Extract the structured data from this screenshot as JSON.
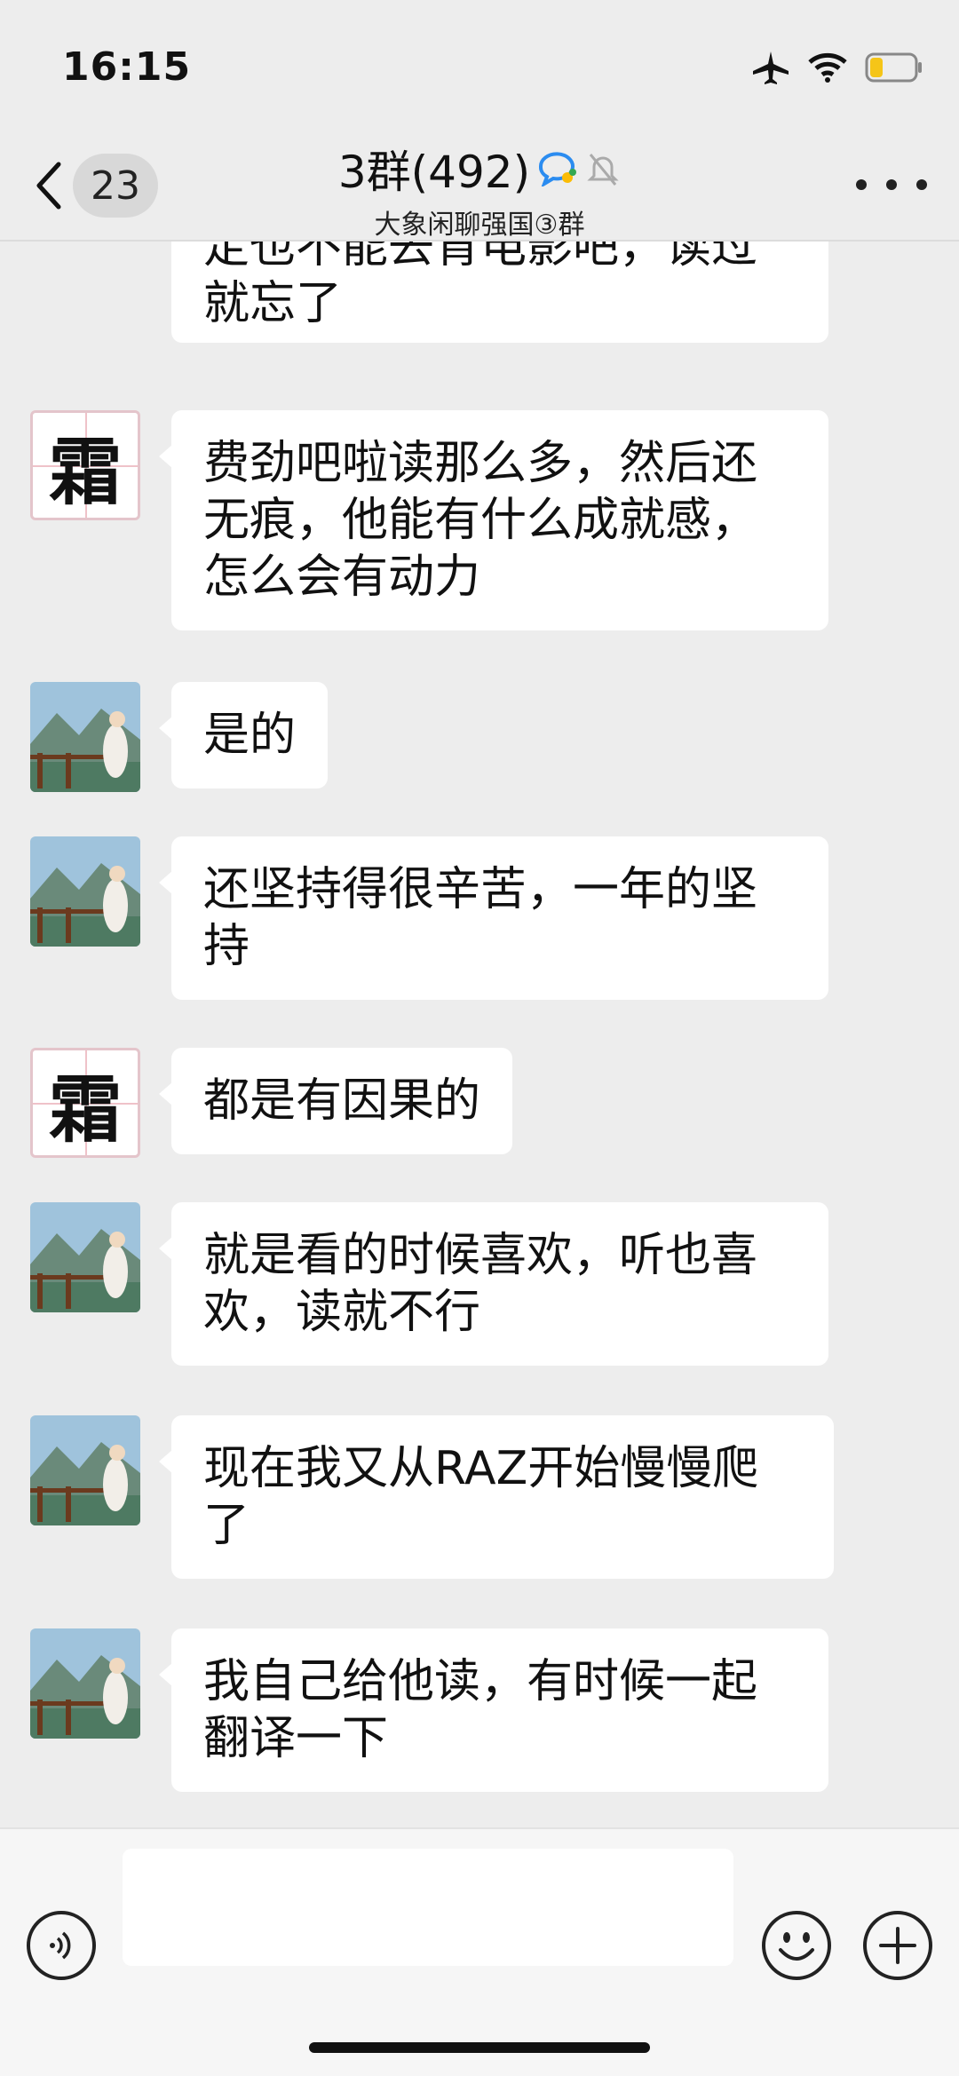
{
  "status_bar": {
    "time": "16:15"
  },
  "nav": {
    "unread_count": "23",
    "title": "3群(492)",
    "subtitle": "大象闲聊强国③群"
  },
  "messages": [
    {
      "sender": "风景头像",
      "text_lines": [
        "定也不能去背电影吧，读过",
        "就忘了"
      ]
    },
    {
      "sender": "霜",
      "text_lines": [
        "费劲吧啦读那么多，然后还",
        "无痕，他能有什么成就感，",
        "怎么会有动力"
      ]
    },
    {
      "sender": "风景头像",
      "text_lines": [
        "是的"
      ]
    },
    {
      "sender": "风景头像",
      "text_lines": [
        "还坚持得很辛苦，一年的坚",
        "持"
      ]
    },
    {
      "sender": "霜",
      "text_lines": [
        "都是有因果的"
      ]
    },
    {
      "sender": "风景头像",
      "text_lines": [
        "就是看的时候喜欢，听也喜",
        "欢，读就不行"
      ]
    },
    {
      "sender": "风景头像",
      "text_lines": [
        "现在我又从RAZ开始慢慢爬",
        "了"
      ]
    },
    {
      "sender": "风景头像",
      "text_lines": [
        "我自己给他读，有时候一起",
        "翻译一下"
      ]
    }
  ],
  "avatar_char": "霜",
  "icons": {
    "airplane": "airplane-icon",
    "wifi": "wifi-icon",
    "battery": "battery-icon",
    "back": "chevron-left-icon",
    "chat_badge": "chat-bubble-icon",
    "mute": "bell-muted-icon",
    "more": "more-dots-icon",
    "voice": "voice-icon",
    "emoji": "emoji-icon",
    "plus": "plus-icon"
  },
  "colors": {
    "background": "#ededed",
    "bubble": "#ffffff",
    "battery_fill": "#f5c518"
  }
}
